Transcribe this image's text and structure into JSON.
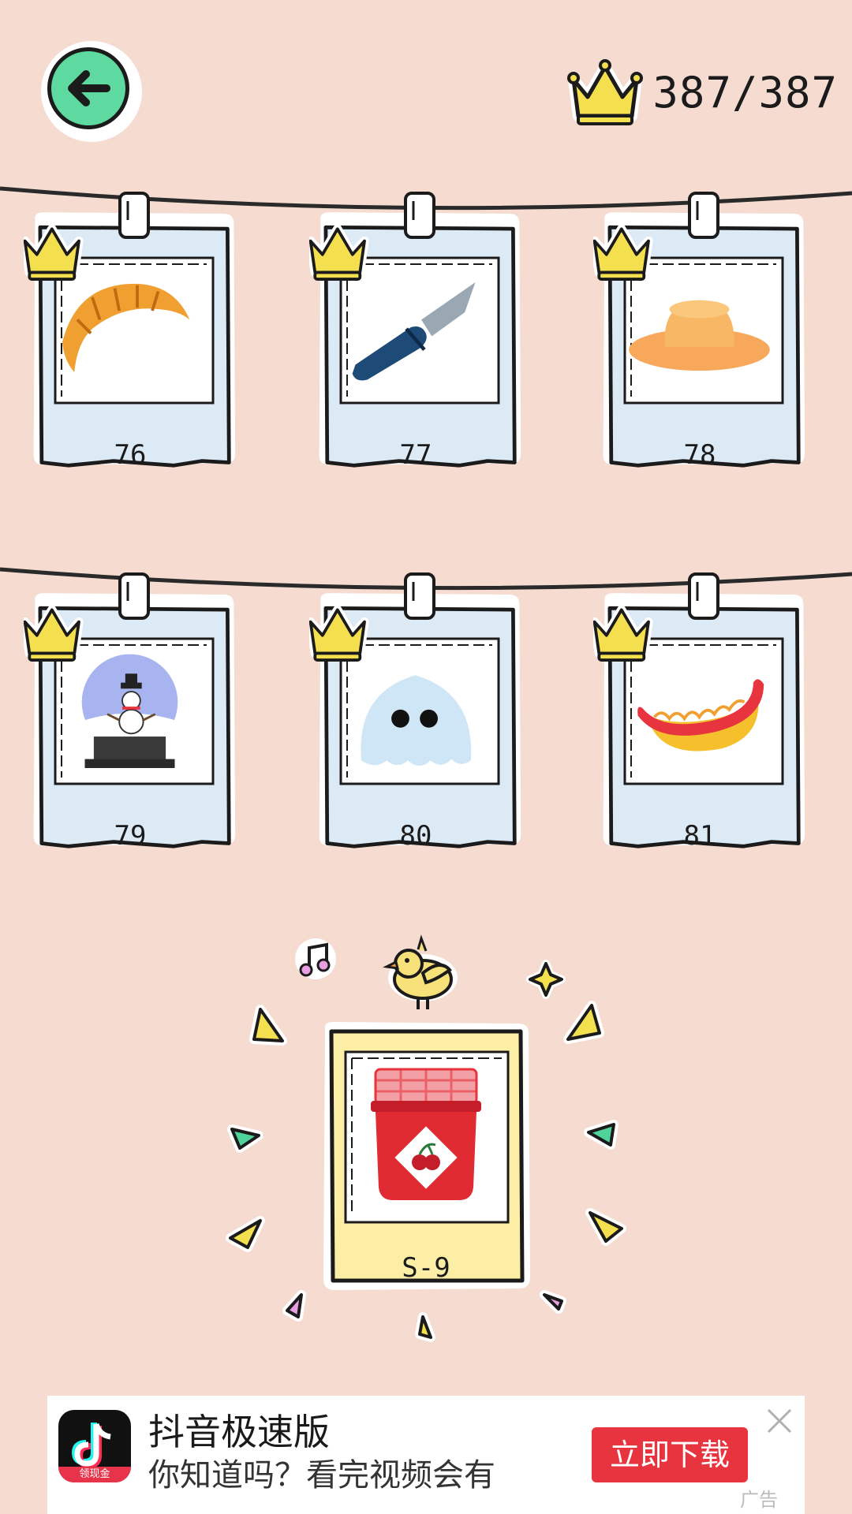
{
  "header": {
    "score": "387/387"
  },
  "levels": [
    {
      "number": "76",
      "item": "croissant"
    },
    {
      "number": "77",
      "item": "knife"
    },
    {
      "number": "78",
      "item": "hat"
    },
    {
      "number": "79",
      "item": "snow-globe"
    },
    {
      "number": "80",
      "item": "ghost"
    },
    {
      "number": "81",
      "item": "hot-dog"
    }
  ],
  "special": {
    "number": "S-9",
    "item": "cherry-jam-jar"
  },
  "ad": {
    "title": "抖音极速版",
    "description": "你知道吗？看完视频会有...",
    "button": "立即下载",
    "icon_tag": "领现金",
    "tag": "广告"
  },
  "colors": {
    "background": "#f5dbd0",
    "card": "#dceaf6",
    "special_card": "#fdeea6",
    "crown": "#f4df4e",
    "back_button": "#5ed9a0",
    "ad_button": "#e8343e"
  }
}
